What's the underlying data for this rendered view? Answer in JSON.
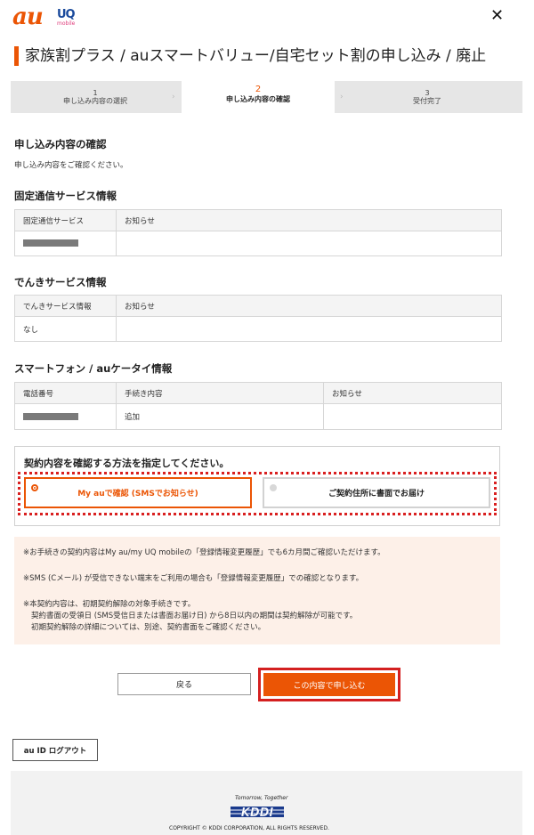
{
  "header": {
    "logo_au": "au",
    "logo_uq": "UQ",
    "logo_uq_sub": "mobile",
    "page_title": "家族割プラス / auスマートバリュー/自宅セット割の申し込み / 廃止"
  },
  "steps": [
    {
      "num": "1",
      "label": "申し込み内容の選択"
    },
    {
      "num": "2",
      "label": "申し込み内容の確認"
    },
    {
      "num": "3",
      "label": "受付完了"
    }
  ],
  "confirm": {
    "heading": "申し込み内容の確認",
    "note": "申し込み内容をご確認ください。"
  },
  "fixed_line": {
    "heading": "固定通信サービス情報",
    "columns": [
      "固定通信サービス",
      "お知らせ"
    ],
    "row": [
      "",
      ""
    ]
  },
  "denki": {
    "heading": "でんきサービス情報",
    "columns": [
      "でんきサービス情報",
      "お知らせ"
    ],
    "row": [
      "なし",
      ""
    ]
  },
  "phone": {
    "heading": "スマートフォン / auケータイ情報",
    "columns": [
      "電話番号",
      "手続き内容",
      "お知らせ"
    ],
    "row": [
      "",
      "追加",
      ""
    ]
  },
  "method": {
    "label": "契約内容を確認する方法を指定してください。",
    "option1": "My auで確認 (SMSでお知らせ)",
    "option2": "ご契約住所に書面でお届け",
    "selected": "option1"
  },
  "info": {
    "line1": "※お手続きの契約内容はMy au/my UQ mobileの「登録情報変更履歴」でも6カ月間ご確認いただけます。",
    "line2": "※SMS (Cメール) が受信できない端末をご利用の場合も「登録情報変更履歴」での確認となります。",
    "line3": "※本契約内容は、初期契約解除の対象手続きです。",
    "line4": "契約書面の受領日 (SMS受信日または書面お届け日) から8日以内の期間は契約解除が可能です。",
    "line5": "初期契約解除の詳細については、別途、契約書面をご確認ください。"
  },
  "buttons": {
    "back": "戻る",
    "submit": "この内容で申し込む",
    "logout": "au ID ログアウト"
  },
  "footer": {
    "tagline": "Tomorrow, Together",
    "brand": "KDDI",
    "copyright": "COPYRIGHT © KDDI CORPORATION, ALL RIGHTS RESERVED."
  },
  "colors": {
    "accent": "#eb5505",
    "highlight": "#d42020",
    "info_bg": "#fdf0e8"
  },
  "icons": {
    "close": "close-icon",
    "step_separator": "chevron-right-icon"
  }
}
